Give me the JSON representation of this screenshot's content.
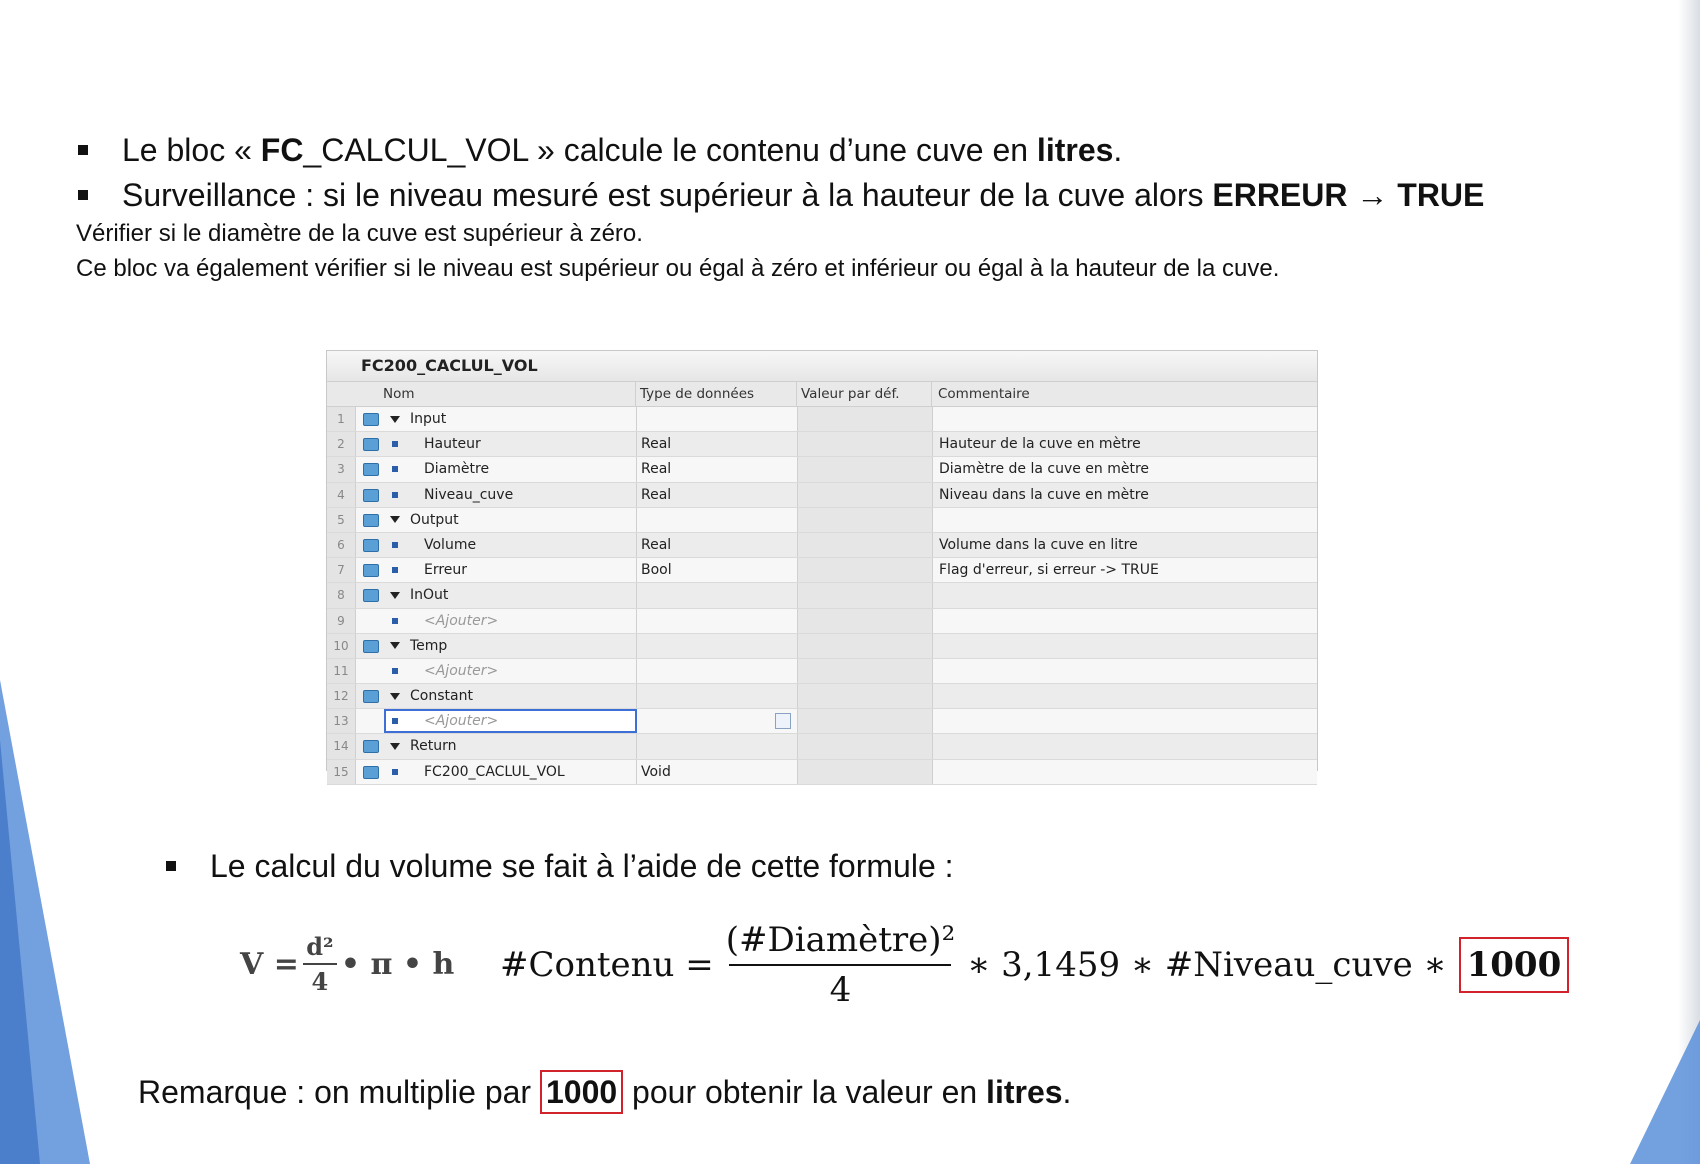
{
  "bullets": {
    "b1": {
      "prefix": "Le bloc « ",
      "bold1": "FC",
      "mid": "_CALCUL_VOL » calcule le contenu d’une cuve en ",
      "bold2": "litres",
      "suffix": "."
    },
    "b2": {
      "prefix": "Surveillance : si le niveau mesuré est supérieur à la hauteur de la cuve alors ",
      "bold1": "ERREUR",
      "arrow": " → ",
      "bold2": "TRUE"
    }
  },
  "lines": {
    "line1": "Vérifier si le diamètre de la cuve est supérieur à zéro.",
    "line2": "Ce bloc va également vérifier si le niveau est supérieur ou égal à zéro et inférieur ou égal à la hauteur de la cuve."
  },
  "table": {
    "title": "FC200_CACLUL_VOL",
    "headers": {
      "nom": "Nom",
      "type": "Type de données",
      "valeur": "Valeur par déf.",
      "commentaire": "Commentaire"
    },
    "rows": [
      {
        "num": "1",
        "kind": "section",
        "name": "Input",
        "type": "",
        "comment": ""
      },
      {
        "num": "2",
        "kind": "item",
        "name": "Hauteur",
        "type": "Real",
        "comment": "Hauteur de la cuve en mètre"
      },
      {
        "num": "3",
        "kind": "item",
        "name": "Diamètre",
        "type": "Real",
        "comment": "Diamètre de la cuve en mètre"
      },
      {
        "num": "4",
        "kind": "item",
        "name": "Niveau_cuve",
        "type": "Real",
        "comment": "Niveau dans la cuve en mètre"
      },
      {
        "num": "5",
        "kind": "section",
        "name": "Output",
        "type": "",
        "comment": ""
      },
      {
        "num": "6",
        "kind": "item",
        "name": "Volume",
        "type": "Real",
        "comment": "Volume dans la cuve en litre"
      },
      {
        "num": "7",
        "kind": "item",
        "name": "Erreur",
        "type": "Bool",
        "comment": "Flag d'erreur, si erreur -> TRUE"
      },
      {
        "num": "8",
        "kind": "section",
        "name": "InOut",
        "type": "",
        "comment": ""
      },
      {
        "num": "9",
        "kind": "add",
        "name": "<Ajouter>",
        "type": "",
        "comment": ""
      },
      {
        "num": "10",
        "kind": "section",
        "name": "Temp",
        "type": "",
        "comment": ""
      },
      {
        "num": "11",
        "kind": "add",
        "name": "<Ajouter>",
        "type": "",
        "comment": ""
      },
      {
        "num": "12",
        "kind": "section",
        "name": "Constant",
        "type": "",
        "comment": ""
      },
      {
        "num": "13",
        "kind": "add-selected",
        "name": "<Ajouter>",
        "type": "",
        "comment": ""
      },
      {
        "num": "14",
        "kind": "section",
        "name": "Return",
        "type": "",
        "comment": ""
      },
      {
        "num": "15",
        "kind": "item",
        "name": "FC200_CACLUL_VOL",
        "type": "Void",
        "comment": ""
      }
    ]
  },
  "calc_bullet": "Le calcul du volume se fait à l’aide de cette formule :",
  "formula_simple": {
    "left": "V =",
    "num": "d²",
    "den": "4",
    "right": "• π • h"
  },
  "formula_main": {
    "left": "#Contenu =",
    "num": "(#Diamètre)²",
    "den": "4",
    "middle": "∗ 3,1459 ∗ #Niveau_cuve  ∗",
    "boxed": "1000"
  },
  "remark": {
    "prefix": "Remarque : on multiplie par ",
    "boxed": "1000",
    "middle": " pour obtenir la valeur en ",
    "bold": "litres",
    "suffix": "."
  },
  "colors": {
    "accent_blue": "#5b8fd9",
    "highlight_red": "#d0232b"
  }
}
